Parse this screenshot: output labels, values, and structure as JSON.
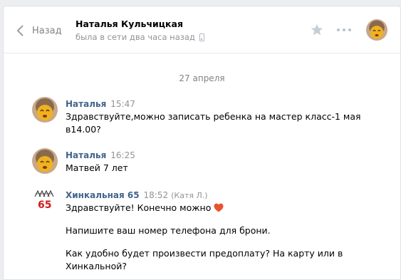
{
  "header": {
    "back_label": "Назад",
    "peer_name": "Наталья Кульчицкая",
    "peer_status": "была в сети два часа назад"
  },
  "date_divider": "27 апреля",
  "logo_text": "65",
  "messages": [
    {
      "author": "Наталья",
      "time": "15:47",
      "lines": [
        "Здравствуйте,можно записать ребенка на мастер класс-1 мая",
        "в14.00?"
      ]
    },
    {
      "author": "Наталья",
      "time": "16:25",
      "lines": [
        "Матвей 7 лет"
      ]
    },
    {
      "author": "Хинкальная 65",
      "time": "18:52",
      "sender": "(Катя Л.)",
      "lines": [
        "Здравствуйте! Конечно можно",
        "Напишите ваш номер телефона для брони.",
        "Как удобно будет произвести предоплату? На карту или в",
        "Хинкальной?"
      ]
    }
  ],
  "colors": {
    "accent": "#42648b",
    "heart": "#e8542e",
    "logo_red": "#d21a1a"
  },
  "icons": [
    "chevron-left-icon",
    "phone-icon",
    "star-icon",
    "more-icon",
    "heart-emoji-icon"
  ]
}
